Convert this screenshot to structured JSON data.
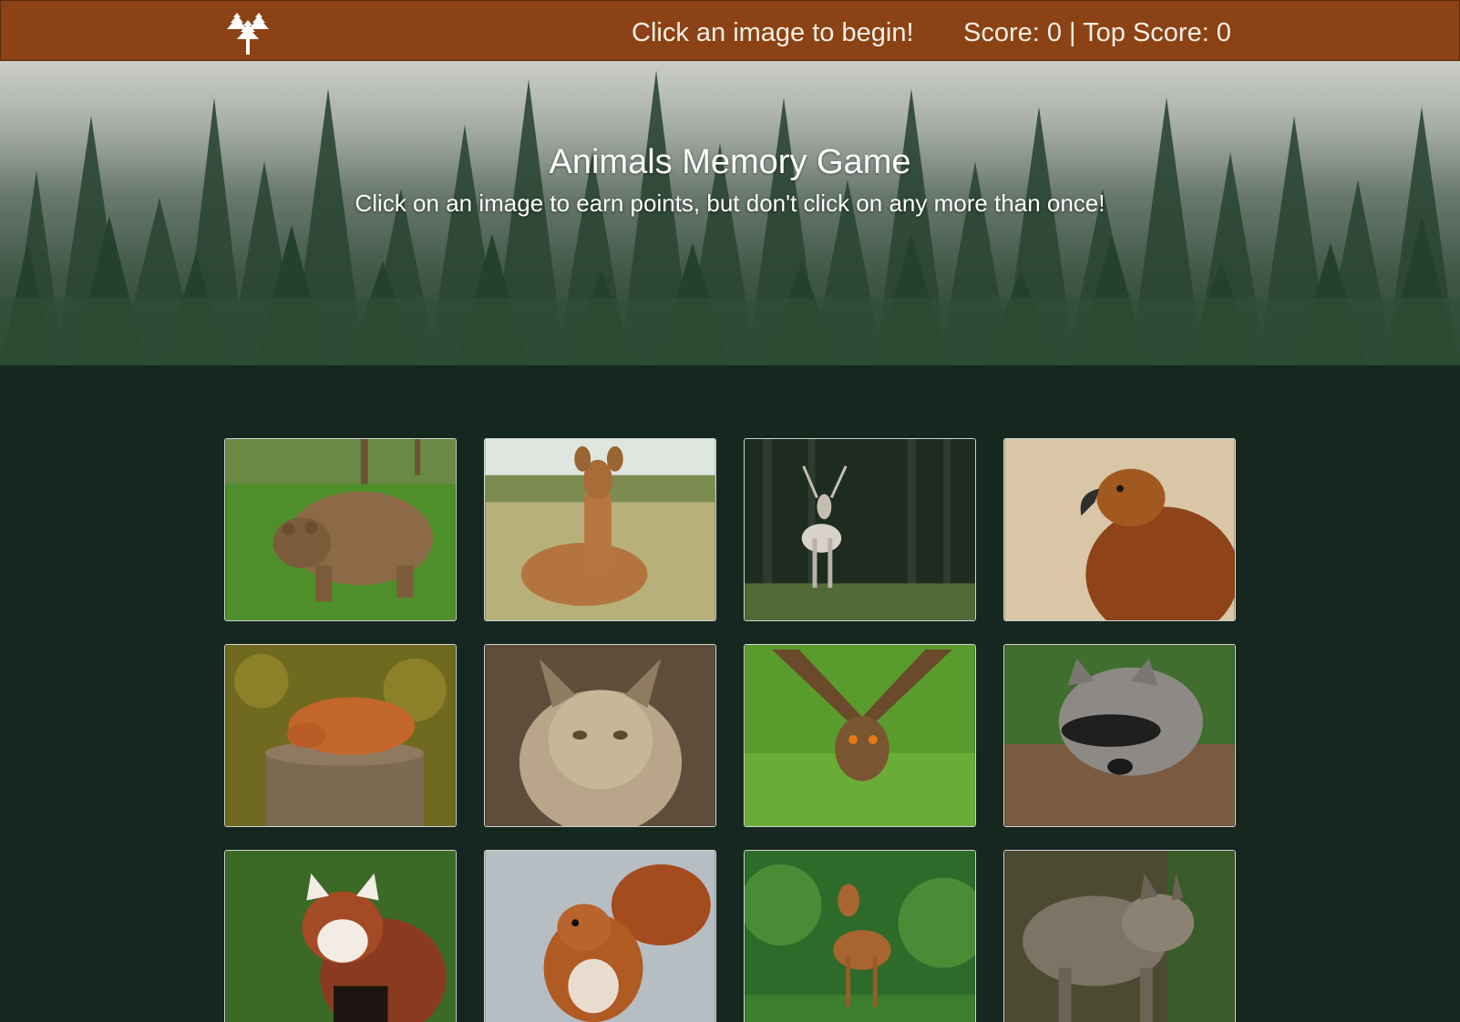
{
  "navbar": {
    "logo_icon": "tree-cluster-icon",
    "message": "Click an image to begin!",
    "score_text": "Score: 0 | Top Score: 0"
  },
  "hero": {
    "title": "Animals Memory Game",
    "subtitle": "Click on an image to earn points, but don't click on any more than once!"
  },
  "colors": {
    "navbar_bg": "#8b4214",
    "page_bg": "#16271f",
    "card_border": "#cfd5d0"
  }
}
